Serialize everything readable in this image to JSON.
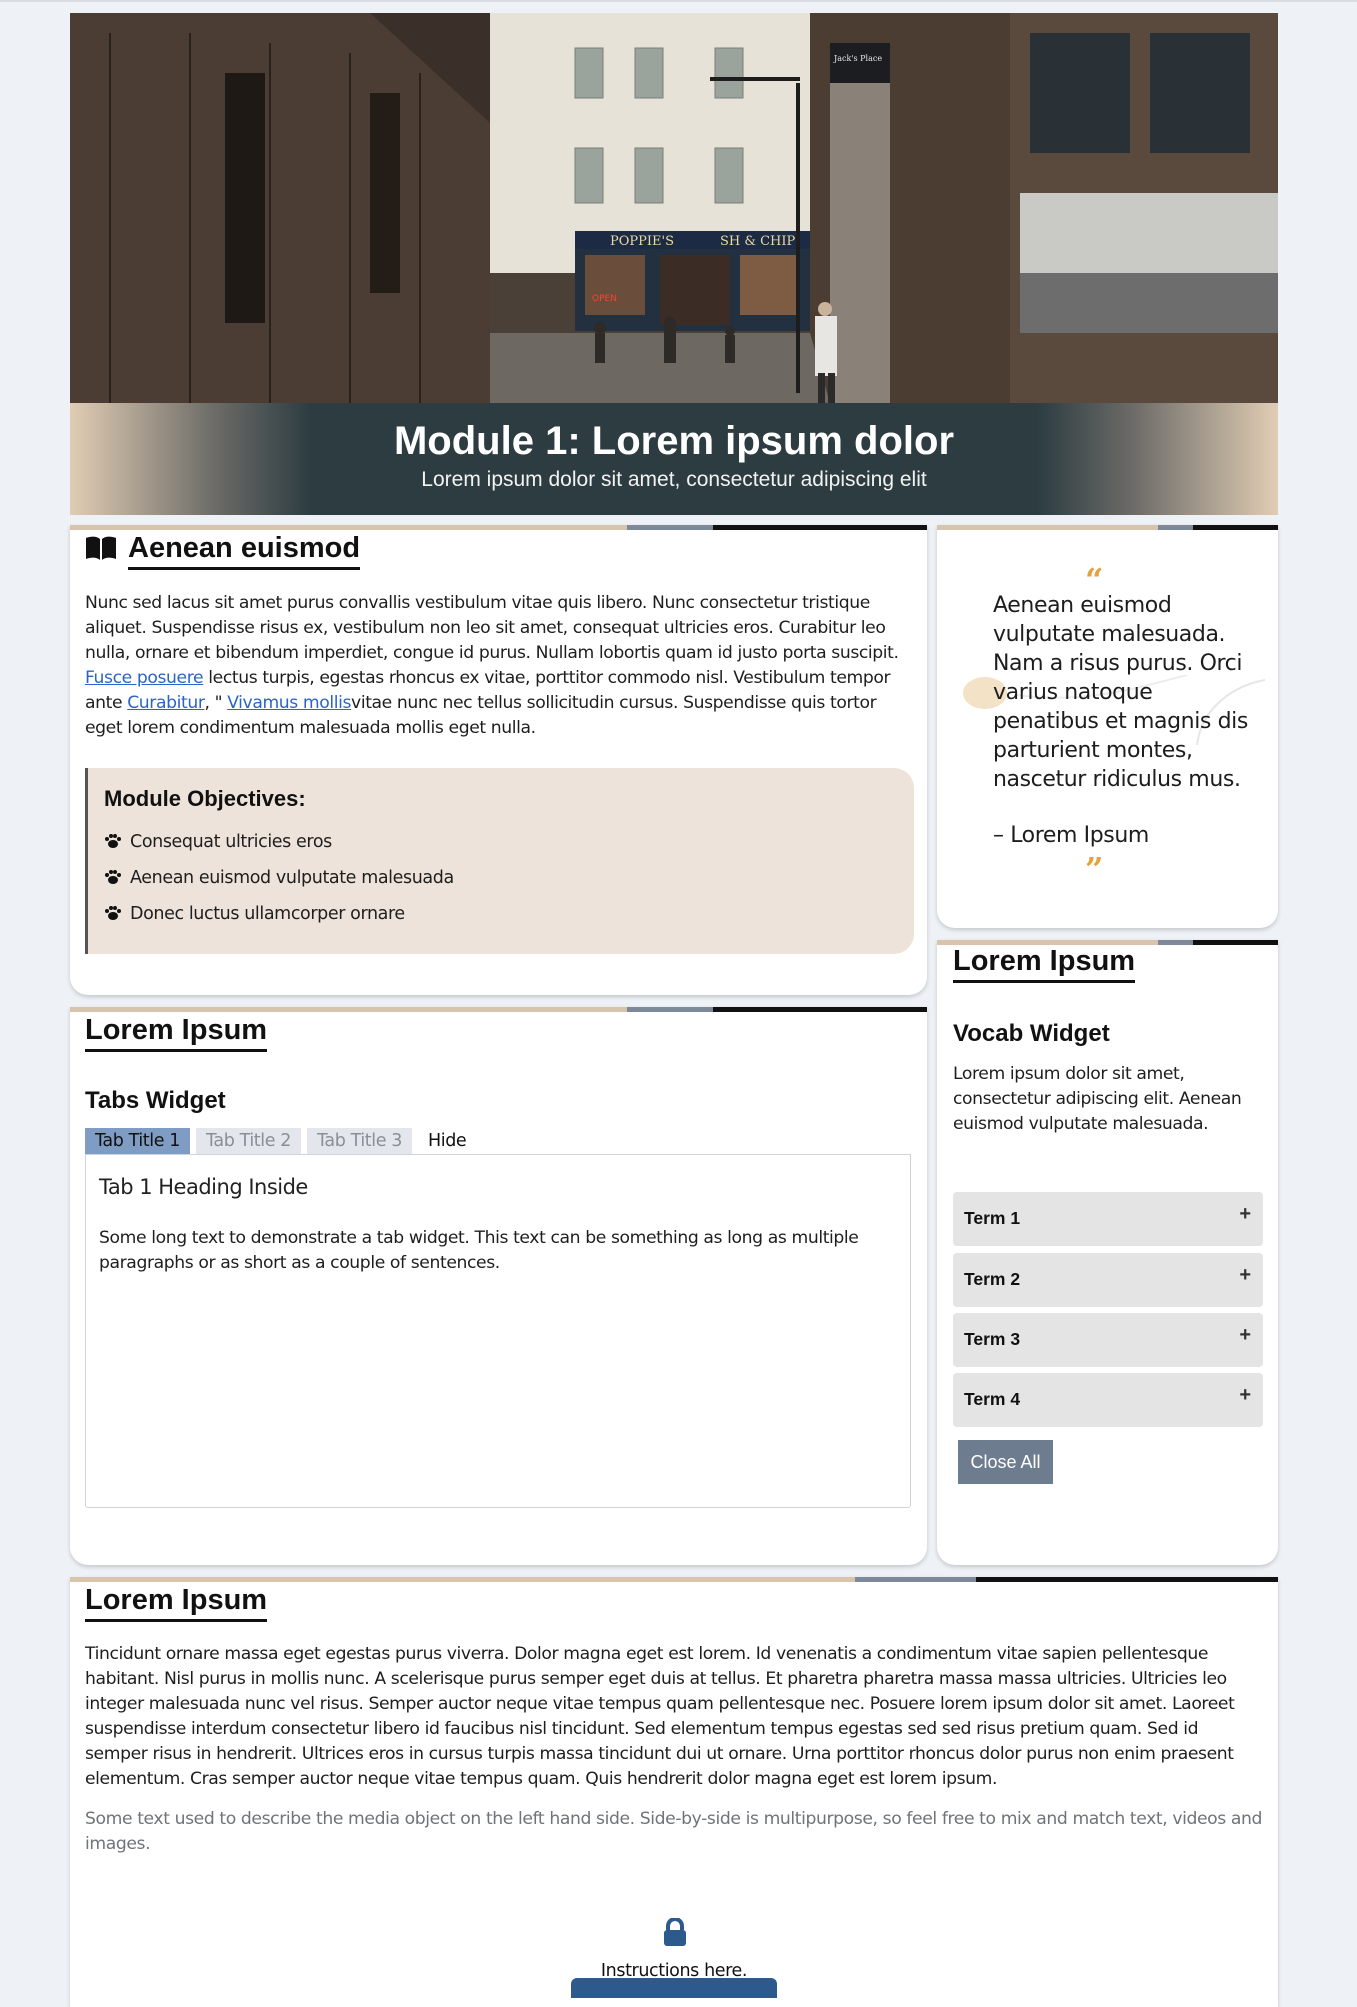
{
  "hero": {
    "title": "Module 1: Lorem ipsum dolor",
    "subtitle": "Lorem ipsum dolor sit amet, consectetur adipiscing elit",
    "sign_left": "POPPIE'S",
    "sign_right": "SH & CHIP",
    "street_sign": "Jack's Place",
    "open_sign": "OPEN"
  },
  "intro": {
    "heading": "Aenean euismod",
    "text_1": "Nunc sed lacus sit amet purus convallis vestibulum vitae quis libero. Nunc consectetur tristique aliquet. Suspendisse risus ex, vestibulum non leo sit amet, consequat ultricies eros. Curabitur leo nulla, ornare et bibendum imperdiet, congue id purus. Nullam lobortis quam id justo porta suscipit. ",
    "link_1": "Fusce posuere",
    "text_2": " lectus turpis, egestas rhoncus ex vitae, porttitor commodo nisl. Vestibulum tempor ante ",
    "link_2": "Curabitur",
    "text_3": ", \" ",
    "link_3": "Vivamus mollis",
    "text_4": "vitae nunc nec tellus sollicitudin cursus. Suspendisse quis tortor eget lorem condimentum malesuada mollis eget nulla.",
    "objectives_title": "Module Objectives:",
    "objectives": [
      "Consequat ultricies eros",
      "Aenean euismod vulputate malesuada",
      "Donec luctus ullamcorper ornare"
    ]
  },
  "quote": {
    "open": "“",
    "text": "Aenean euismod vulputate malesuada. Nam a risus purus. Orci varius natoque penatibus et magnis dis parturient montes, nascetur ridiculus mus.",
    "author": "– Lorem Ipsum",
    "close": "”"
  },
  "tabs_section": {
    "heading": "Lorem Ipsum",
    "widget_title": "Tabs Widget",
    "tabs": [
      "Tab Title 1",
      "Tab Title 2",
      "Tab Title 3"
    ],
    "hide_label": "Hide",
    "panel_heading": "Tab 1 Heading Inside",
    "panel_text": "Some long text to demonstrate a tab widget. This text can be something as long as multiple paragraphs or as short as a couple of sentences."
  },
  "vocab_section": {
    "heading": "Lorem Ipsum",
    "widget_title": "Vocab Widget",
    "description": "Lorem ipsum dolor sit amet, consectetur adipiscing elit. Aenean euismod vulputate malesuada.",
    "terms": [
      "Term 1",
      "Term 2",
      "Term 3",
      "Term 4"
    ],
    "plus": "+",
    "close_all": "Close All"
  },
  "bottom_section": {
    "heading": "Lorem Ipsum",
    "paragraph": "Tincidunt ornare massa eget egestas purus viverra. Dolor magna eget est lorem. Id venenatis a condimentum vitae sapien pellentesque habitant. Nisl purus in mollis nunc. A scelerisque purus semper eget duis at tellus. Et pharetra pharetra massa massa ultricies. Ultricies leo integer malesuada nunc vel risus. Semper auctor neque vitae tempus quam pellentesque nec. Posuere lorem ipsum dolor sit amet. Laoreet suspendisse interdum consectetur libero id faucibus nisl tincidunt. Sed elementum tempus egestas sed sed risus pretium quam. Sed id semper risus in hendrerit. Ultrices eros in cursus turpis massa tincidunt dui ut ornare. Urna porttitor rhoncus dolor purus non enim praesent elementum. Cras semper auctor neque vitae tempus quam. Quis hendrerit dolor magna eget est lorem ipsum.",
    "media_text": "Some text used to describe the media object on the left hand side. Side-by-side is multipurpose, so feel free to mix and match text, videos and images.",
    "instructions": "Instructions here."
  },
  "icons": {
    "book": "book-open-icon",
    "paw": "paw-icon",
    "quote": "quote-icon",
    "lock": "lock-icon",
    "plus": "plus-icon"
  },
  "colors": {
    "accent_tan": "#d8c4ad",
    "accent_slate": "#7d8899",
    "accent_black": "#111111",
    "objectives_bg": "#ede3da",
    "tab_active": "#7f9cc4",
    "close_all_bg": "#6e7c90",
    "quote_marks": "#e3a23c",
    "link": "#2a64c8"
  }
}
